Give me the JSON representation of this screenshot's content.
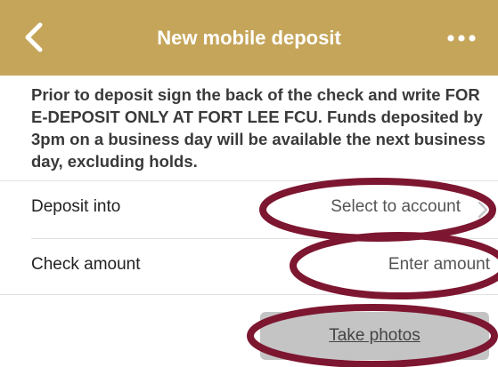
{
  "header": {
    "title": "New mobile deposit",
    "back_icon": "chevron-left-icon",
    "more_icon": "more-horizontal-icon",
    "background_color": "#c5a55a"
  },
  "intro_text": "Prior to deposit sign the back of the check and write FOR E-DEPOSIT ONLY AT FORT LEE FCU.  Funds deposited by 3pm on a business day will be available the next business day, excluding holds.",
  "form": {
    "deposit_into": {
      "label": "Deposit into",
      "value": "Select to account",
      "icon": "chevron-right-icon"
    },
    "check_amount": {
      "label": "Check amount",
      "placeholder": "Enter amount"
    }
  },
  "take_photos_label": "Take photos",
  "annotation_color": "#7d1630"
}
